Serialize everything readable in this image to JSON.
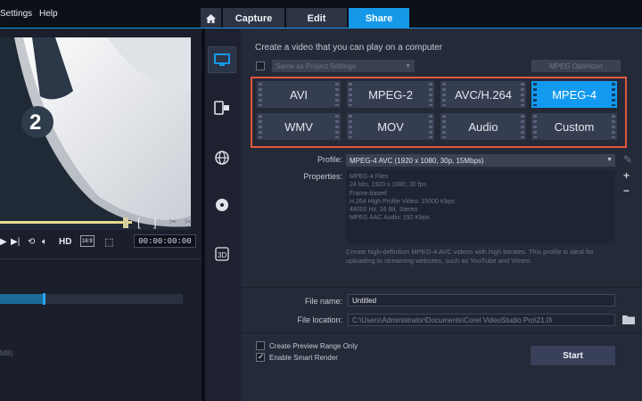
{
  "menu": {
    "settings": "Settings",
    "help": "Help"
  },
  "tabs": {
    "home_icon": "home-icon",
    "capture": "Capture",
    "edit": "Edit",
    "share": "Share"
  },
  "player": {
    "clip_number": "2",
    "hd_label": "HD",
    "ratio_label": "16:9",
    "in_mark": "[",
    "out_mark": "]",
    "timecode": "00:00:00:00",
    "size_fragment": "MB)"
  },
  "share": {
    "heading": "Create a video that you can play on a computer",
    "same_as_project": "Same as Project Settings",
    "mpeg_optimizer": "MPEG Optimizer",
    "formats": [
      "AVI",
      "MPEG-2",
      "AVC/H.264",
      "MPEG-4",
      "WMV",
      "MOV",
      "Audio",
      "Custom"
    ],
    "selected_format": "MPEG-4",
    "profile_label": "Profile:",
    "profile_value": "MPEG-4 AVC (1920 x 1080, 30p, 15Mbps)",
    "properties_label": "Properties:",
    "properties": [
      "MPEG-4 Files",
      "24 bits, 1920 x 1080, 30 fps",
      "Frame-based",
      "H.264 High Profile Video: 15000 Kbps",
      "48000 Hz, 16 Bit, Stereo",
      "MPEG AAC Audio: 192 Kbps"
    ],
    "description": "Create high-definition MPEG-4 AVC videos with high bitrates. This profile is ideal for uploading to streaming websites, such as YouTube and Vimeo.",
    "file_name_label": "File name:",
    "file_name_value": "Untitled",
    "file_location_label": "File location:",
    "file_location_value": "C:\\Users\\Administrator\\Documents\\Corel VideoStudio Pro\\21.0\\",
    "preview_range": "Create Preview Range Only",
    "smart_render": "Enable Smart Render",
    "start": "Start"
  },
  "colors": {
    "accent": "#1598e8",
    "highlight_border": "#e05a3b"
  }
}
